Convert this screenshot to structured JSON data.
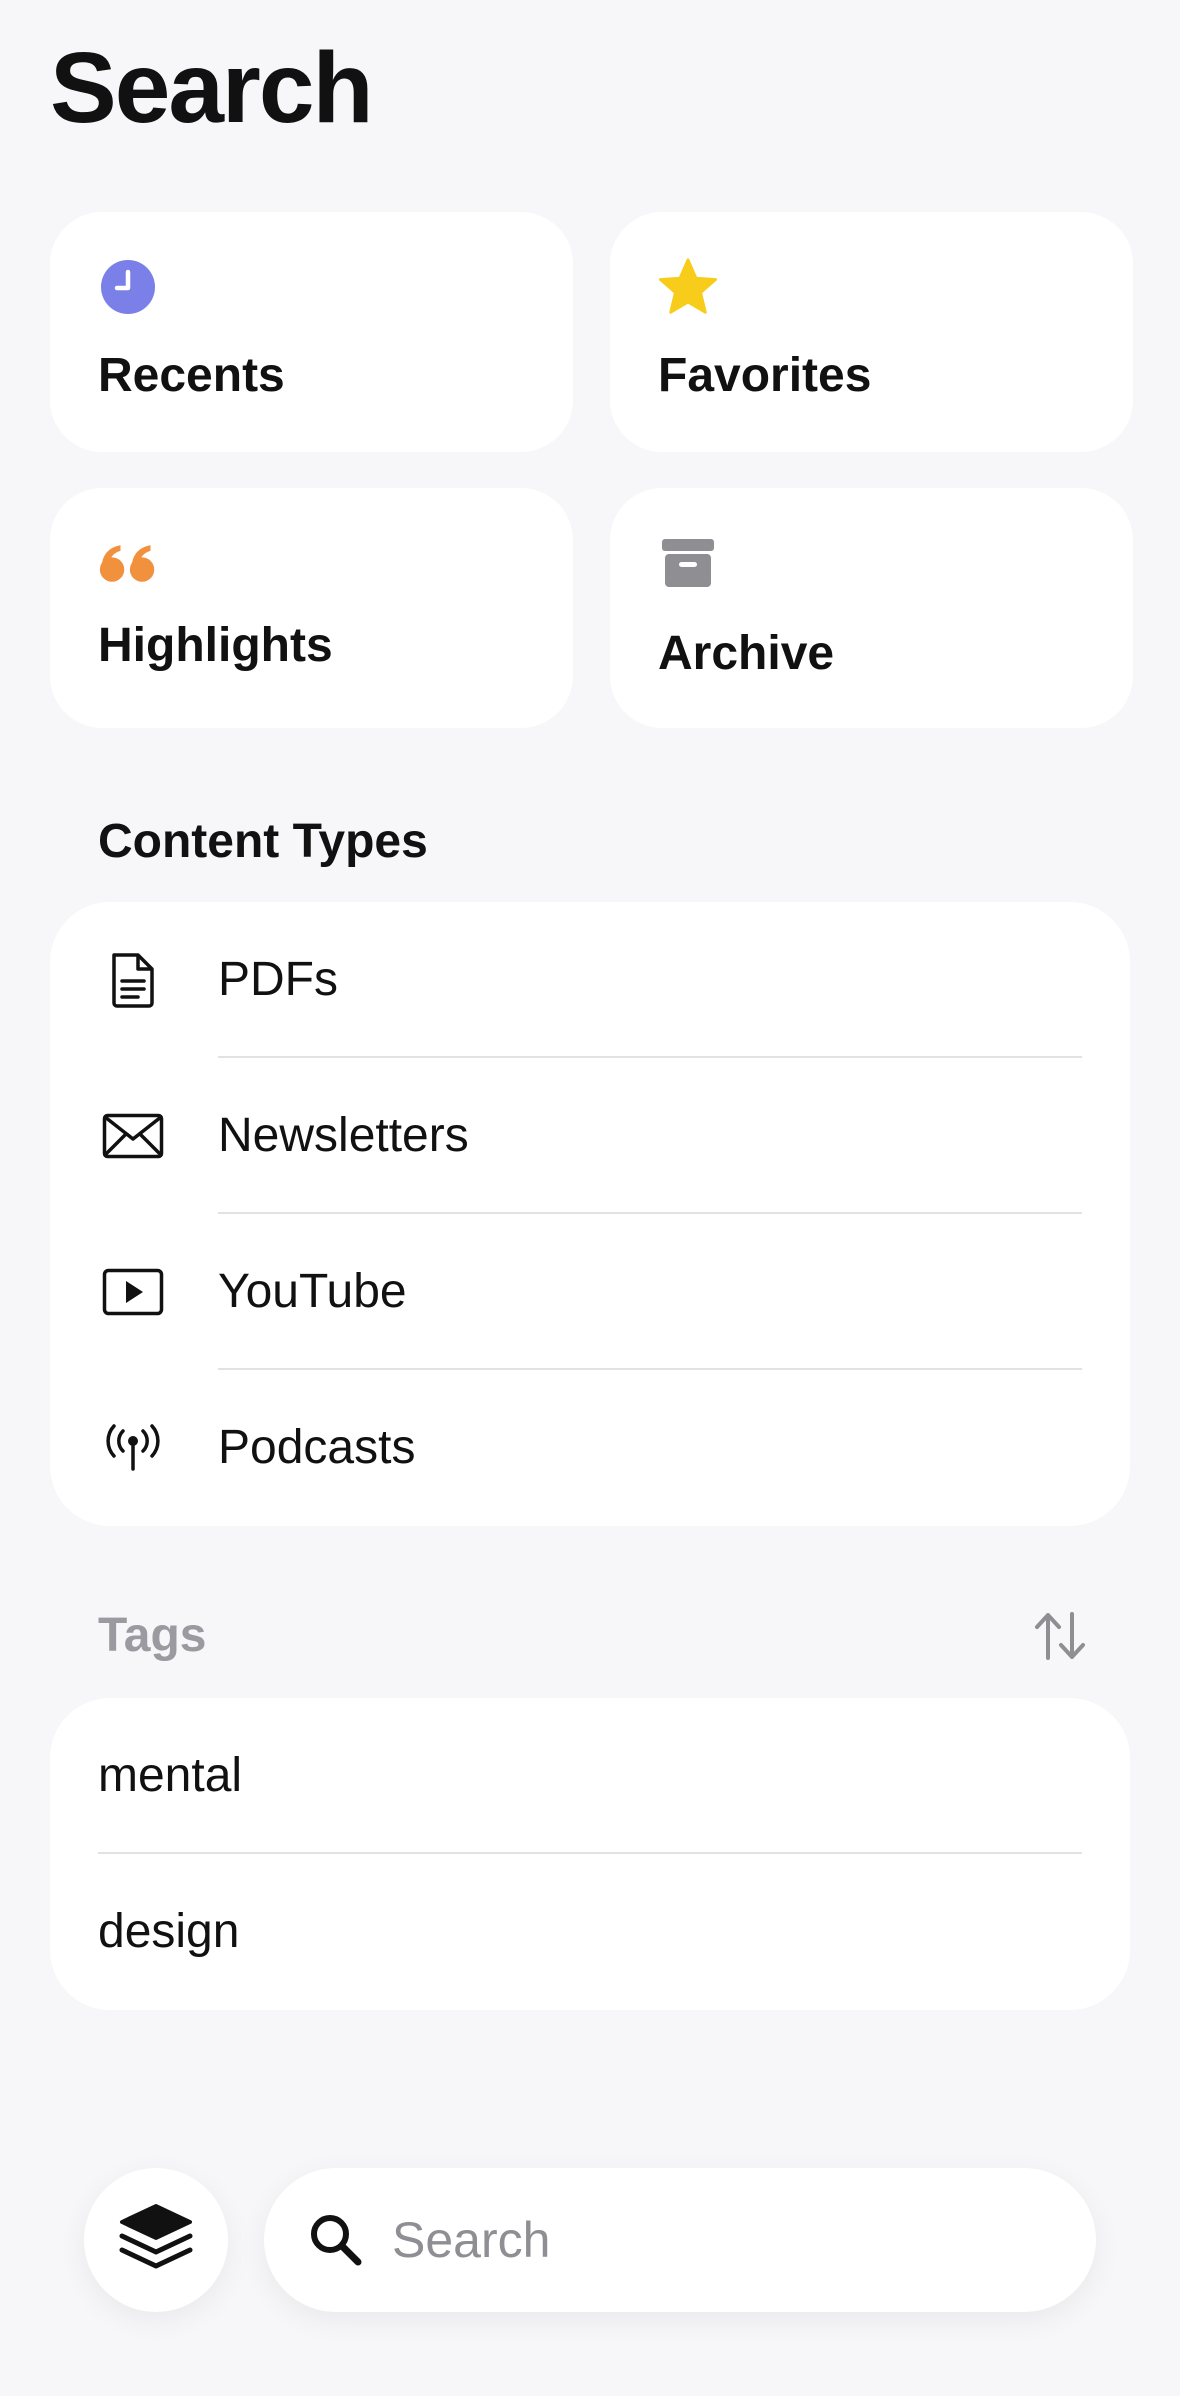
{
  "header": {
    "title": "Search"
  },
  "quick_tiles": [
    {
      "label": "Recents",
      "icon": "clock-icon",
      "color": "#7b7fe8"
    },
    {
      "label": "Favorites",
      "icon": "star-icon",
      "color": "#f8cc1b"
    },
    {
      "label": "Highlights",
      "icon": "quote-icon",
      "color": "#f2913d"
    },
    {
      "label": "Archive",
      "icon": "archive-box-icon",
      "color": "#8e8e93"
    }
  ],
  "content_types": {
    "title": "Content Types",
    "items": [
      {
        "label": "PDFs",
        "icon": "document-icon"
      },
      {
        "label": "Newsletters",
        "icon": "envelope-icon"
      },
      {
        "label": "YouTube",
        "icon": "play-video-icon"
      },
      {
        "label": "Podcasts",
        "icon": "antenna-broadcast-icon"
      }
    ]
  },
  "tags": {
    "title": "Tags",
    "sort_icon": "sort-arrows-icon",
    "items": [
      {
        "label": "mental"
      },
      {
        "label": "design"
      }
    ]
  },
  "bottom_bar": {
    "layers_icon": "layers-stack-icon",
    "search_placeholder": "Search",
    "search_icon": "magnifier-icon"
  }
}
